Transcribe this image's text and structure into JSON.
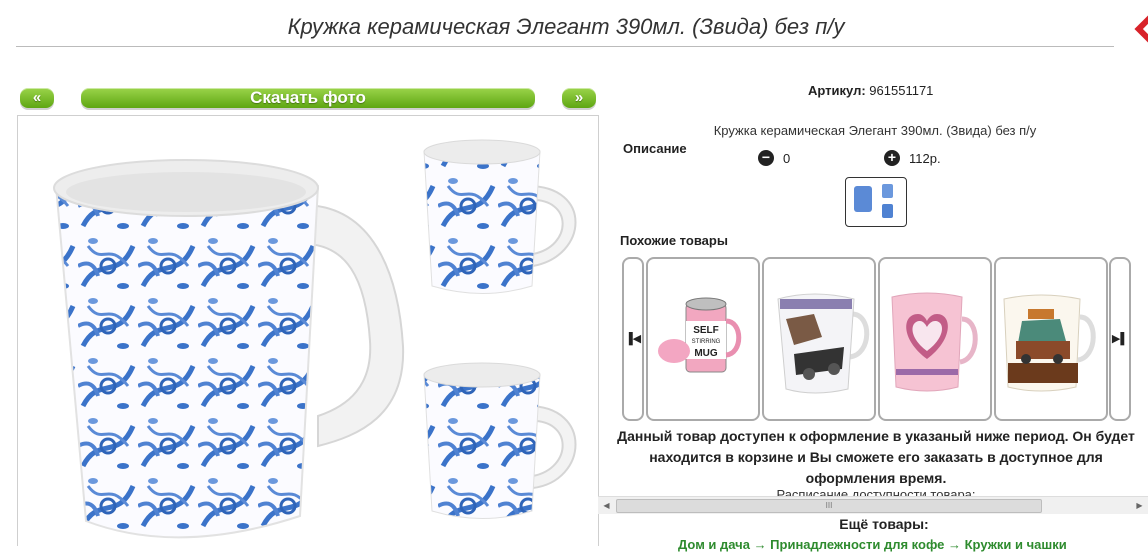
{
  "product": {
    "title": "Кружка керамическая Элегант 390мл. (Звида) без п/у",
    "article_label": "Артикул:",
    "article_value": "961551171",
    "description_label": "Описание",
    "description_text": "Кружка керамическая Элегант 390мл. (Звида) без п/у",
    "quantity": "0",
    "price": "112р."
  },
  "photo_nav": {
    "prev_label": "«",
    "download_label": "Скачать фото",
    "next_label": "»"
  },
  "similar": {
    "label": "Похожие товары",
    "prev_icon": "▐◀",
    "next_icon": "▶▌",
    "items": [
      {
        "name": "self-stirring-mug",
        "text1": "SELF",
        "text2": "STIRRING",
        "text3": "MUG"
      },
      {
        "name": "cars-mug"
      },
      {
        "name": "heart-mug"
      },
      {
        "name": "retro-car-mug"
      }
    ]
  },
  "availability_text": "Данный товар доступен к оформление в указаный ниже период. Он будет находится в корзине и Вы сможете его заказать в доступное для оформления время.",
  "schedule_text": "Расписание доступности товара:",
  "scrollbar": {
    "left": "◀",
    "right": "▶",
    "grip": "III"
  },
  "more_label": "Ещё товары:",
  "category_links": "Дом и дача → Принадлежности для кофе → Кружки и чашки",
  "colors": {
    "accent_green": "#5ea612",
    "mug_blue": "#3b73c9",
    "logo_red": "#d8232a"
  },
  "icons": [
    "minus-circle-icon",
    "plus-circle-icon",
    "carousel-prev-icon",
    "carousel-next-icon"
  ]
}
